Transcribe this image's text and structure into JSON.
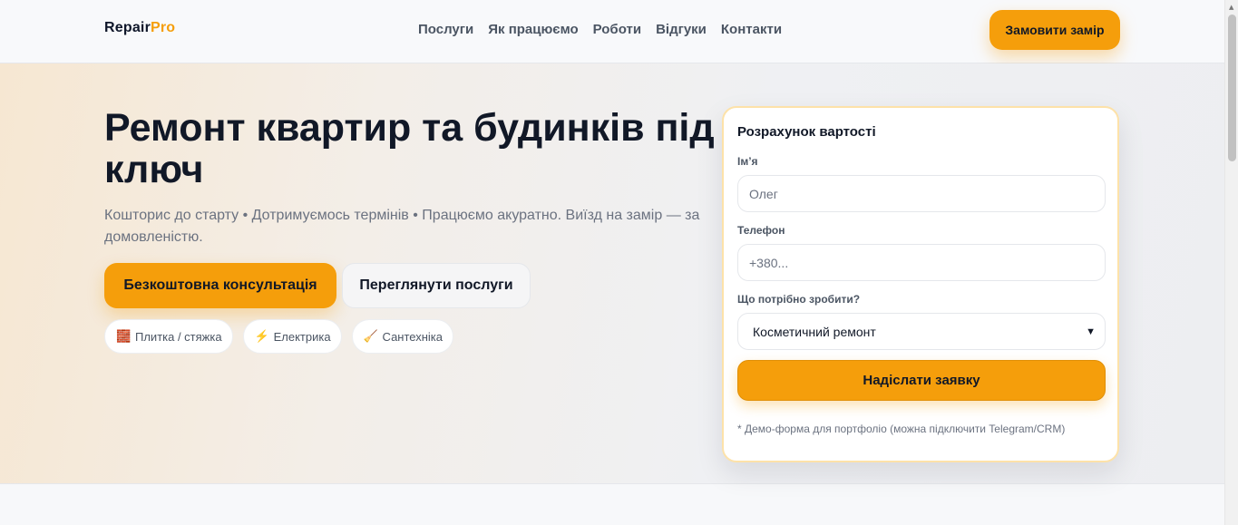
{
  "header": {
    "logo_main": "Repair",
    "logo_accent": "Pro",
    "nav": [
      "Послуги",
      "Як працюємо",
      "Роботи",
      "Відгуки",
      "Контакти"
    ],
    "cta": "Замовити замір"
  },
  "hero": {
    "title": "Ремонт квартир та будинків під ключ",
    "subtitle": "Кошторис до старту • Дотримуємось термінів • Працюємо акуратно. Виїзд на замір — за домовленістю.",
    "primary_button": "Безкоштовна консультація",
    "secondary_button": "Переглянути послуги",
    "chips": [
      {
        "icon": "brick-icon",
        "glyph": "🧱",
        "label": "Плитка / стяжка"
      },
      {
        "icon": "lightning-icon",
        "glyph": "⚡",
        "label": "Електрика"
      },
      {
        "icon": "broom-icon",
        "glyph": "🧹",
        "label": "Сантехніка"
      }
    ]
  },
  "form": {
    "title": "Розрахунок вартості",
    "name_label": "Ім’я",
    "name_placeholder": "Олег",
    "phone_label": "Телефон",
    "phone_placeholder": "+380...",
    "task_label": "Що потрібно зробити?",
    "task_selected": "Косметичний ремонт",
    "submit": "Надіслати заявку",
    "note": "* Демо-форма для портфоліо (можна підключити Telegram/CRM)"
  },
  "colors": {
    "accent": "#f59e0b",
    "text_dark": "#111827",
    "text_muted": "#6b7280"
  }
}
